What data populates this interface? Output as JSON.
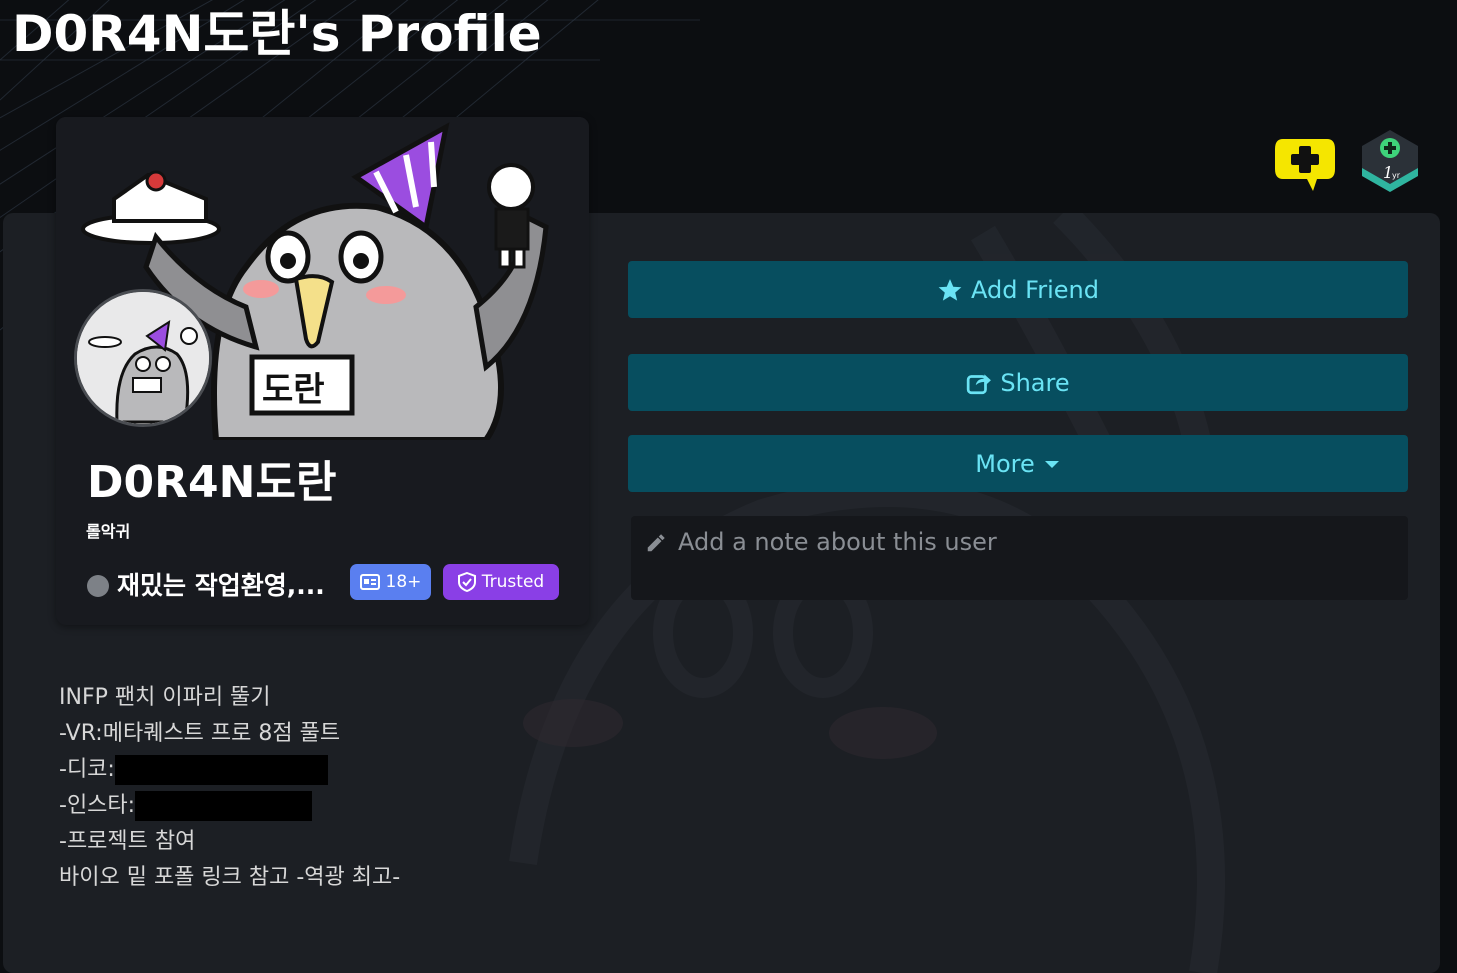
{
  "page": {
    "title": "D0R4N도란's Profile"
  },
  "profile": {
    "display_name": "D0R4N도란",
    "pronouns": "롤악귀",
    "status_text": "재밌는 작업환영,...",
    "status_color": "#7d8187",
    "badges": [
      {
        "label": "18+",
        "icon": "id-card-icon",
        "color": "#5a7ff0"
      },
      {
        "label": "Trusted",
        "icon": "shield-check-icon",
        "color": "#8a3fe6"
      }
    ],
    "banner_text": "도란"
  },
  "actions": {
    "add_friend": "Add Friend",
    "share": "Share",
    "more": "More"
  },
  "note": {
    "placeholder": "Add a note about this user"
  },
  "bio": {
    "lines": [
      "INFP 팬치 이파리 뚤기",
      "-VR:메타퀘스트 프로 8점 풀트",
      "-디코:",
      "-인스타:",
      "-프로젝트 참여",
      "바이오 밑 포폴 링크 참고 -역광 최고-"
    ]
  },
  "header_icons": [
    {
      "name": "vrc-plus-icon",
      "color": "#f5e600"
    },
    {
      "name": "one-year-badge-icon",
      "label": "1yr",
      "color": "#2fb5a0"
    }
  ],
  "colors": {
    "button_bg": "#074e5f",
    "button_text": "#6ae3f4",
    "panel_bg": "#1c1f24",
    "page_bg": "#0c0e11"
  }
}
